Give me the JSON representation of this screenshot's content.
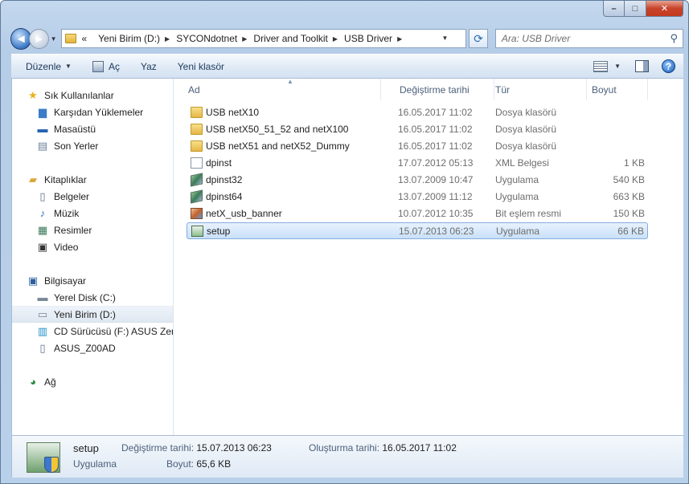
{
  "window": {
    "caption_buttons": {
      "minimize": "–",
      "maximize": "□",
      "close": "✕"
    }
  },
  "navigation": {
    "back_glyph": "◄",
    "forward_glyph": "►",
    "crumb_prefix": "«",
    "breadcrumbs": [
      "Yeni Birim (D:)",
      "SYCONdotnet",
      "Driver and Toolkit",
      "USB Driver"
    ],
    "search_placeholder": "Ara: USB Driver"
  },
  "toolbar": {
    "organize": "Düzenle",
    "open": "Aç",
    "print": "Yaz",
    "new_folder": "Yeni klasör",
    "help": "?"
  },
  "sidebar": {
    "favorites": {
      "header": "Sık Kullanılanlar",
      "items": [
        "Karşıdan Yüklemeler",
        "Masaüstü",
        "Son Yerler"
      ]
    },
    "libraries": {
      "header": "Kitaplıklar",
      "items": [
        "Belgeler",
        "Müzik",
        "Resimler",
        "Video"
      ]
    },
    "computer": {
      "header": "Bilgisayar",
      "items": [
        "Yerel Disk (C:)",
        "Yeni Birim (D:)",
        "CD Sürücüsü (F:) ASUS ZenU",
        "ASUS_Z00AD"
      ],
      "selected_index": 1
    },
    "network": {
      "header": "Ağ"
    }
  },
  "columns": {
    "name": "Ad",
    "date": "Değiştirme tarihi",
    "type": "Tür",
    "size": "Boyut"
  },
  "files": [
    {
      "name": "USB netX10",
      "date": "16.05.2017 11:02",
      "type": "Dosya klasörü",
      "size": "",
      "icon": "folder-icon"
    },
    {
      "name": "USB netX50_51_52 and netX100",
      "date": "16.05.2017 11:02",
      "type": "Dosya klasörü",
      "size": "",
      "icon": "folder-icon"
    },
    {
      "name": "USB netX51 and netX52_Dummy",
      "date": "16.05.2017 11:02",
      "type": "Dosya klasörü",
      "size": "",
      "icon": "folder-icon"
    },
    {
      "name": "dpinst",
      "date": "17.07.2012 05:13",
      "type": "XML Belgesi",
      "size": "1 KB",
      "icon": "xml-file-icon"
    },
    {
      "name": "dpinst32",
      "date": "13.07.2009 10:47",
      "type": "Uygulama",
      "size": "540 KB",
      "icon": "application-icon"
    },
    {
      "name": "dpinst64",
      "date": "13.07.2009 11:12",
      "type": "Uygulama",
      "size": "663 KB",
      "icon": "application-icon"
    },
    {
      "name": "netX_usb_banner",
      "date": "10.07.2012 10:35",
      "type": "Bit eşlem resmi",
      "size": "150 KB",
      "icon": "bitmap-icon"
    },
    {
      "name": "setup",
      "date": "15.07.2013 06:23",
      "type": "Uygulama",
      "size": "66 KB",
      "icon": "setup-icon"
    }
  ],
  "selected_file_index": 7,
  "details": {
    "name": "setup",
    "type": "Uygulama",
    "modified_label": "Değiştirme tarihi:",
    "modified_value": "15.07.2013 06:23",
    "created_label": "Oluşturma tarihi:",
    "created_value": "16.05.2017 11:02",
    "size_label": "Boyut:",
    "size_value": "65,6 KB"
  }
}
